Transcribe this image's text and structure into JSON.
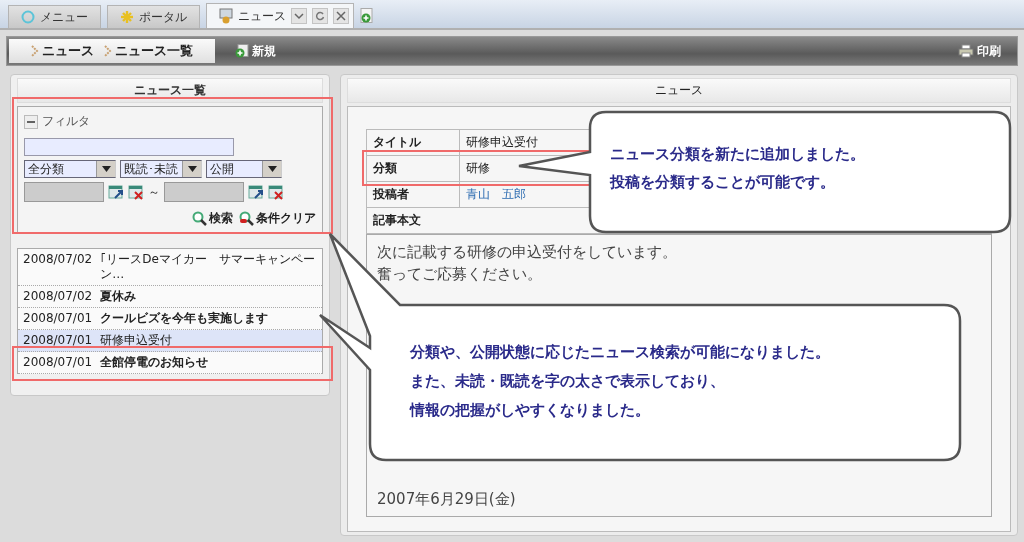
{
  "tabs": [
    {
      "label": "メニュー",
      "kind": "menu",
      "selected": false
    },
    {
      "label": "ポータル",
      "kind": "portal",
      "selected": false
    },
    {
      "label": "ニュース",
      "kind": "news",
      "selected": true
    }
  ],
  "toolbar": {
    "breadcrumb": [
      "ニュース",
      "ニュース一覧"
    ],
    "new_button": "新規",
    "print_button": "印刷"
  },
  "list_panel": {
    "title": "ニュース一覧",
    "filter": {
      "label": "フィルタ",
      "expanded": true,
      "category": "全分類",
      "read_state": "既読･未読",
      "visibility": "公開",
      "range_separator": "～",
      "search_button": "検索",
      "clear_button": "条件クリア"
    },
    "items": [
      {
        "date": "2008/07/02",
        "title": "｢リースDeマイカー　サマーキャンペーン…",
        "read": true,
        "selected": false
      },
      {
        "date": "2008/07/02",
        "title": "夏休み",
        "read": false,
        "selected": false
      },
      {
        "date": "2008/07/01",
        "title": "クールビズを今年も実施します",
        "read": false,
        "selected": false
      },
      {
        "date": "2008/07/01",
        "title": "研修申込受付",
        "read": true,
        "selected": true
      },
      {
        "date": "2008/07/01",
        "title": "全館停電のお知らせ",
        "read": false,
        "selected": false
      }
    ]
  },
  "detail_panel": {
    "title": "ニュース",
    "fields": [
      {
        "label": "タイトル",
        "value": "研修申込受付",
        "kind": "text"
      },
      {
        "label": "分類",
        "value": "研修",
        "kind": "text"
      },
      {
        "label": "投稿者",
        "value": "青山　五郎",
        "kind": "link"
      }
    ],
    "body_label": "記事本文",
    "body_lines": [
      "次に記載する研修の申込受付をしています。",
      "奮ってご応募ください。"
    ],
    "body_date": "2007年6月29日(金)"
  },
  "callouts": [
    {
      "lines": [
        "ニュース分類を新たに追加しました。",
        "投稿を分類することが可能です。"
      ]
    },
    {
      "lines": [
        "分類や、公開状態に応じたニュース検索が可能になりました。",
        "また、未読・既読を字の太さで表示しており、",
        "情報の把握がしやすくなりました。"
      ]
    }
  ]
}
